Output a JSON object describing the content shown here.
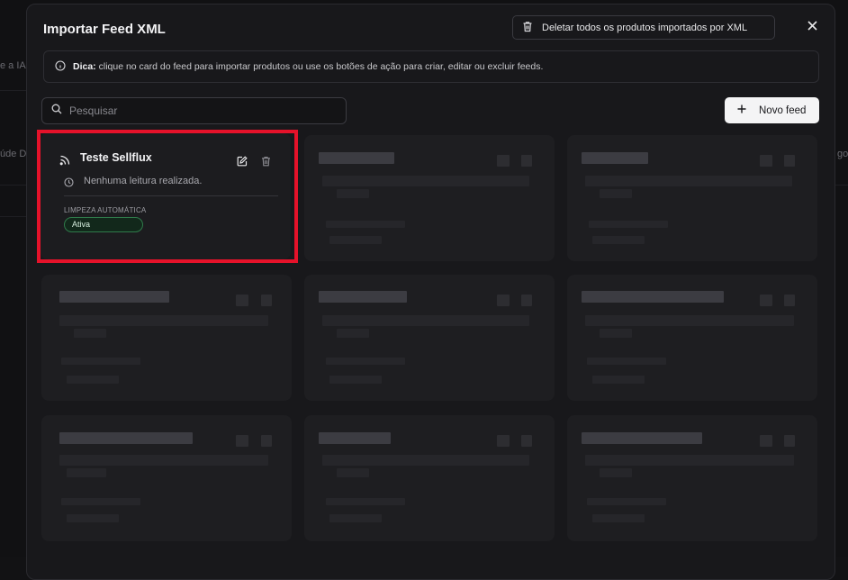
{
  "background": {
    "fragment_left_1": "e a IA",
    "fragment_left_2": "úde D",
    "fragment_right": "go"
  },
  "modal": {
    "title": "Importar Feed XML",
    "delete_all_label": "Deletar todos os produtos importados por XML",
    "tip_prefix": "Dica:",
    "tip_text": " clique no card do feed para importar produtos ou use os botões de ação para criar, editar ou excluir feeds.",
    "search_placeholder": "Pesquisar",
    "new_feed_label": "Novo feed"
  },
  "feeds": [
    {
      "name": "Teste Sellflux",
      "last_read": "Nenhuma leitura realizada.",
      "cleanup_label": "LIMPEZA AUTOMÁTICA",
      "cleanup_status": "Ativa"
    }
  ],
  "colors": {
    "highlight": "#e5122a",
    "badge_border": "#2f7a4a",
    "primary_button": "#f4f4f5"
  },
  "icons": [
    "delete-icon",
    "close-icon",
    "info-icon",
    "search-icon",
    "plus-icon",
    "rss-icon",
    "edit-icon",
    "trash-icon",
    "clock-icon"
  ]
}
